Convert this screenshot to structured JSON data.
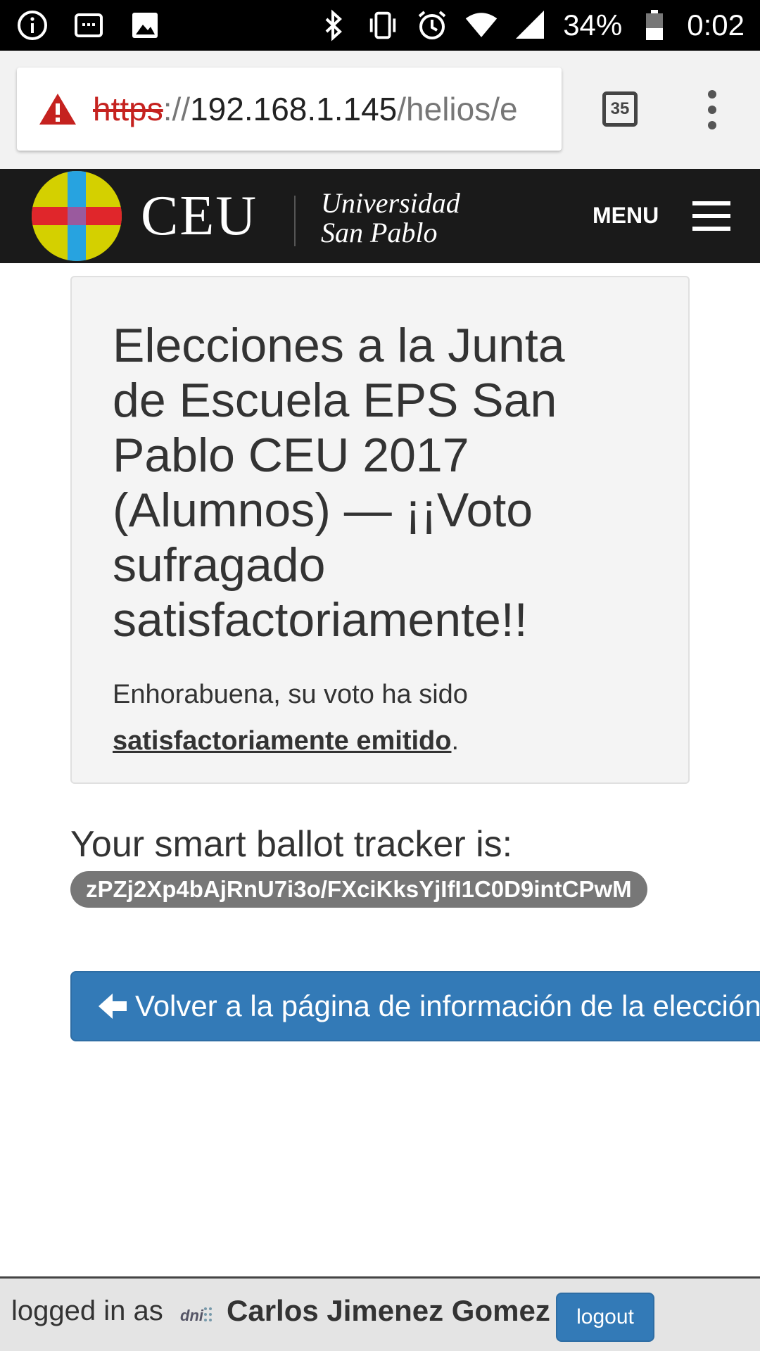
{
  "status_bar": {
    "battery_percent": "34%",
    "time": "0:02",
    "left_icons": [
      "info-icon",
      "notification-icon",
      "image-icon"
    ],
    "right_icons": [
      "bluetooth-icon",
      "vibrate-icon",
      "alarm-icon",
      "wifi-icon",
      "signal-icon",
      "battery-icon"
    ]
  },
  "browser": {
    "url_scheme": "https",
    "url_separator": "://",
    "url_host": "192.168.1.145",
    "url_path": "/helios/e",
    "tab_count": "35",
    "security_icon": "warning-icon"
  },
  "header": {
    "logo_word": "CEU",
    "university_line1": "Universidad",
    "university_line2": "San Pablo",
    "menu_label": "MENU",
    "colors": {
      "logo_yellow": "#d4d000",
      "logo_red": "#e0262b",
      "logo_blue": "#27a3e0",
      "logo_center": "#9a5a9e"
    }
  },
  "panel": {
    "title": "Elecciones a la Junta de Escuela EPS San Pablo CEU 2017 (Alumnos) — ¡¡Voto sufragado satisfactoriamente!!",
    "message_prefix": "Enhorabuena, su voto ha sido ",
    "message_emphasis": "satisfactoriamente emitido",
    "message_suffix": "."
  },
  "tracker": {
    "heading": "Your smart ballot tracker is:",
    "value": "zPZj2Xp4bAjRnU7i3o/FXciKksYjIfI1C0D9intCPwM"
  },
  "return_button": {
    "label": "Volver a la página de información de la elección"
  },
  "footer": {
    "logged_in_label": "logged in as",
    "dni_label": "dni",
    "user_name": "Carlos Jimenez Gomez",
    "logout_label": "logout"
  },
  "colors": {
    "primary_button": "#337ab7",
    "badge": "#777777",
    "header_bg": "#1a1a1a"
  }
}
